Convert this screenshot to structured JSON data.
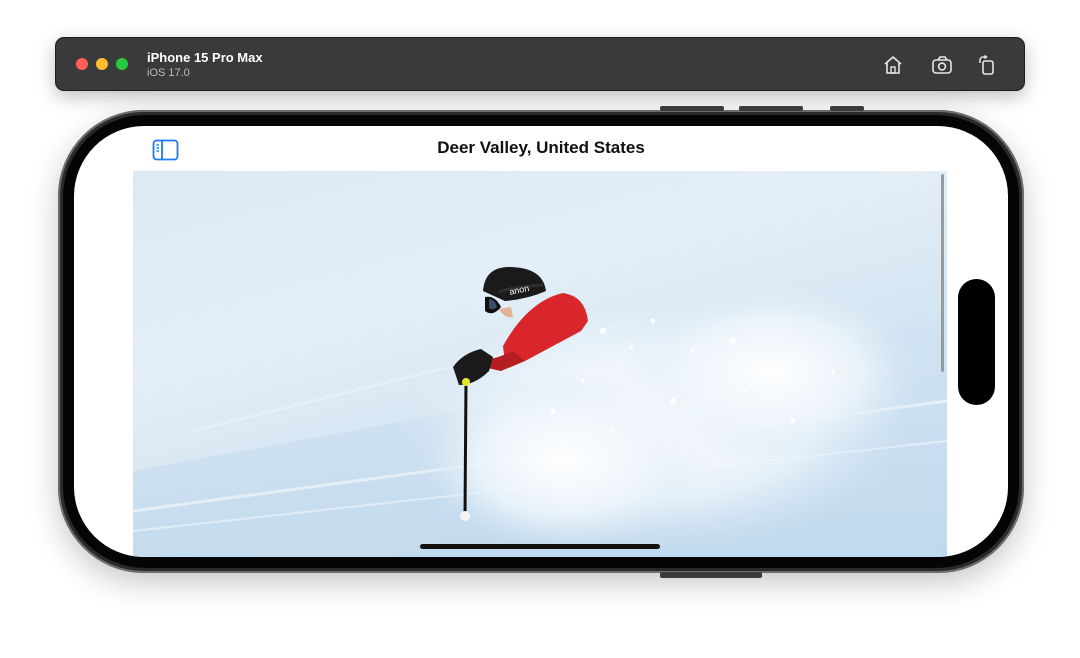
{
  "simulator": {
    "device_name": "iPhone 15 Pro Max",
    "os_version": "iOS 17.0",
    "toolbar_icons": [
      "home-icon",
      "screenshot-icon",
      "rotate-icon"
    ]
  },
  "app": {
    "nav_title": "Deer Valley, United States",
    "sidebar_icon": "sidebar-icon",
    "accent_color": "#1a7cf5"
  },
  "photo": {
    "helmet_text": "anon"
  }
}
